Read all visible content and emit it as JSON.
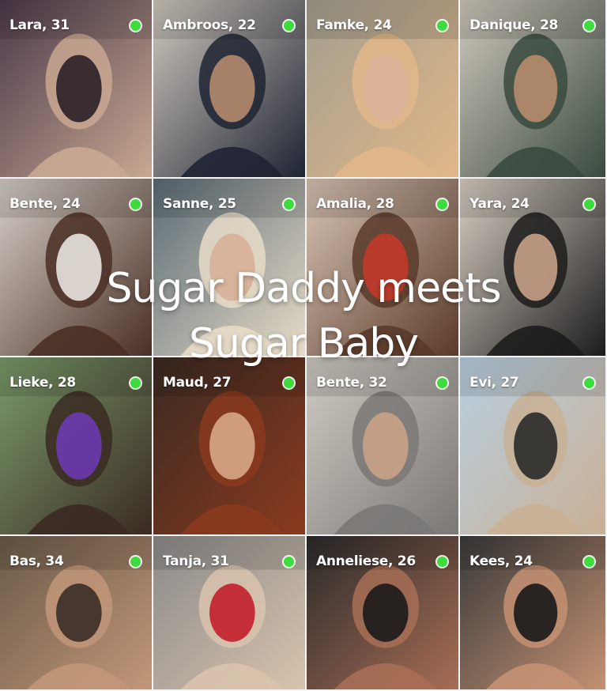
{
  "overlay": {
    "line1": "Sugar Daddy meets",
    "line2": "Sugar Baby"
  },
  "colors": {
    "online": "#3ddc3d",
    "label": "#ffffff"
  },
  "profiles": [
    {
      "label": "Lara, 31",
      "online": true,
      "tones": [
        "#4b3a4a",
        "#c9a892",
        "#2a2028"
      ]
    },
    {
      "label": "Ambroos, 22",
      "online": true,
      "tones": [
        "#cfc8be",
        "#1f2433",
        "#b48a6d"
      ]
    },
    {
      "label": "Famke, 24",
      "online": true,
      "tones": [
        "#a39e8f",
        "#e1b788",
        "#d9b39a"
      ]
    },
    {
      "label": "Danique, 28",
      "online": true,
      "tones": [
        "#cfc8bd",
        "#3a4a3f",
        "#b78c6b"
      ]
    },
    {
      "label": "Bente, 24",
      "online": true,
      "tones": [
        "#d6cfc9",
        "#4a2f24",
        "#e8e3df"
      ]
    },
    {
      "label": "Sanne, 25",
      "online": true,
      "tones": [
        "#5a6b75",
        "#e8dcc8",
        "#d6b097"
      ]
    },
    {
      "label": "Amalia, 28",
      "online": true,
      "tones": [
        "#d8c5b5",
        "#5a3a2a",
        "#c23a2a"
      ]
    },
    {
      "label": "Yara, 24",
      "online": true,
      "tones": [
        "#d8cfc4",
        "#1c1c1c",
        "#c7a087"
      ]
    },
    {
      "label": "Lieke, 28",
      "online": true,
      "tones": [
        "#7a9a6a",
        "#3a2a22",
        "#6a3ab0"
      ]
    },
    {
      "label": "Maud, 27",
      "online": true,
      "tones": [
        "#3a2a22",
        "#8a3a1e",
        "#d7a887"
      ]
    },
    {
      "label": "Bente, 32",
      "online": true,
      "tones": [
        "#cfcac3",
        "#7a7875",
        "#c9a286"
      ]
    },
    {
      "label": "Evi, 27",
      "online": true,
      "tones": [
        "#b8cfe0",
        "#c9b095",
        "#2a2a2a"
      ]
    },
    {
      "label": "Bas, 34",
      "online": true,
      "tones": [
        "#6a5a48",
        "#c29779",
        "#3a2e28"
      ]
    },
    {
      "label": "Tanja, 31",
      "online": true,
      "tones": [
        "#8a8a8a",
        "#d9c3ad",
        "#c21e2a"
      ]
    },
    {
      "label": "Anneliese, 26",
      "online": true,
      "tones": [
        "#2a2a2a",
        "#a86e55",
        "#1a1a1a"
      ]
    },
    {
      "label": "Kees, 24",
      "online": true,
      "tones": [
        "#3a3a3a",
        "#c49172",
        "#181818"
      ]
    }
  ]
}
